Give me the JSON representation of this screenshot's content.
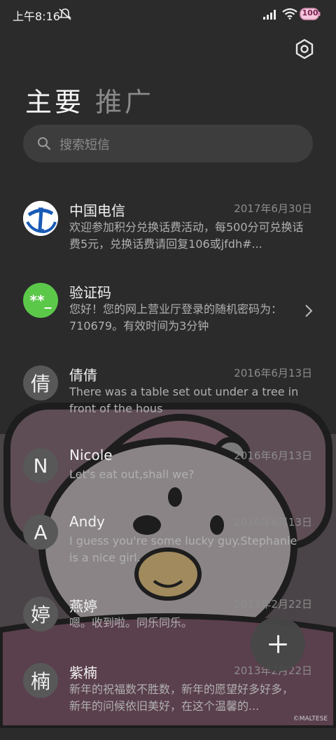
{
  "status_bar": {
    "time": "上午8:16",
    "battery": "100"
  },
  "tabs": {
    "main": "主要",
    "promotions": "推广"
  },
  "search": {
    "placeholder": "搜索短信"
  },
  "messages": [
    {
      "sender": "中国电信",
      "date": "2017年6月30日",
      "preview": "欢迎参加积分兑换话费活动，每500分可兑换话费5元，兑换话费请回复106或jfdh#...",
      "avatar": "telecom-logo"
    },
    {
      "sender": "验证码",
      "date": "",
      "preview": "您好！您的网上营业厅登录的随机密码为：710679。有效时间为3分钟",
      "avatar_text": "**_",
      "avatar_color": "#5cc84a"
    },
    {
      "sender": "倩倩",
      "date": "2016年6月13日",
      "preview": "There was a table set out under a tree in front of the hous",
      "avatar_text": "倩"
    },
    {
      "sender": "Nicole",
      "date": "2016年6月13日",
      "preview": "Let's eat out,shall we?",
      "avatar_text": "N"
    },
    {
      "sender": "Andy",
      "date": "2016年6月13日",
      "preview": "I guess you're some lucky guy.Stephanie is a nice girl.",
      "avatar_text": "A"
    },
    {
      "sender": "燕婷",
      "date": "2013年2月22日",
      "preview": "嗯。收到啦。同乐同乐。",
      "avatar_text": "婷"
    },
    {
      "sender": "紫楠",
      "date": "2013年2月22日",
      "preview": "新年的祝福数不胜数，新年的愿望好多好多，新年的问候依旧美好，在这个温馨的...",
      "avatar_text": "楠"
    }
  ],
  "watermark": "©MALTESE",
  "colors": {
    "background": "#2b2b2b",
    "search_bg": "#3d3d3d",
    "avatar_default": "#585858",
    "code_green": "#5cc84a"
  }
}
